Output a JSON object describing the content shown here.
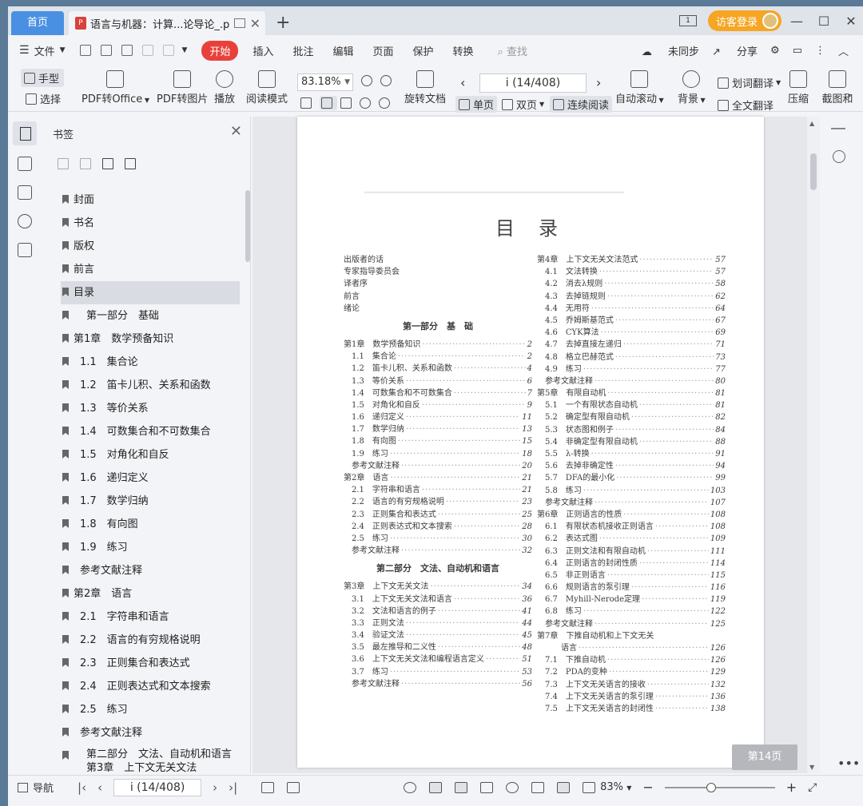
{
  "tabs": {
    "home": "首页",
    "doc_title": "语言与机器：计算...论导论_.pdf",
    "login": "访客登录"
  },
  "menu": {
    "file": "文件",
    "items": [
      "开始",
      "插入",
      "批注",
      "编辑",
      "页面",
      "保护",
      "转换"
    ],
    "search": "查找",
    "right": [
      "未同步",
      "分享"
    ]
  },
  "ribbon": {
    "hand": "手型",
    "select": "选择",
    "pdf_office": "PDF转Office",
    "pdf_image": "PDF转图片",
    "play": "播放",
    "read_mode": "阅读模式",
    "zoom": "83.18%",
    "rotate_doc": "旋转文档",
    "page_indicator": "i (14/408)",
    "single": "单页",
    "double": "双页",
    "continuous": "连续阅读",
    "auto_scroll": "自动滚动",
    "background": "背景",
    "word_translate": "划词翻译",
    "full_translate": "全文翻译",
    "compress": "压缩",
    "screenshot": "截图和"
  },
  "bookmarks": {
    "title": "书签",
    "items": [
      "封面",
      "书名",
      "版权",
      "前言",
      "目录",
      "第一部分　基础",
      "第1章　数学预备知识",
      "1.1　集合论",
      "1.2　笛卡儿积、关系和函数",
      "1.3　等价关系",
      "1.4　可数集合和不可数集合",
      "1.5　对角化和自反",
      "1.6　递归定义",
      "1.7　数学归纳",
      "1.8　有向图",
      "1.9　练习",
      "参考文献注释",
      "第2章　语言",
      "2.1　字符串和语言",
      "2.2　语言的有穷规格说明",
      "2.3　正则集合和表达式",
      "2.4　正则表达式和文本搜索",
      "2.5　练习",
      "参考文献注释",
      "第二部分　文法、自动机和语言第3章　上下文无关文法"
    ]
  },
  "toc": {
    "title": "目录",
    "front": [
      "出版者的话",
      "专家指导委员会",
      "译者序",
      "前言",
      "绪论"
    ],
    "part1": "第一部分　基　础",
    "part2": "第二部分　文法、自动机和语言",
    "left": [
      {
        "t": "第1章　数学预备知识",
        "p": "2",
        "ch": true
      },
      {
        "t": "1.1　集合论",
        "p": "2"
      },
      {
        "t": "1.2　笛卡儿积、关系和函数",
        "p": "4"
      },
      {
        "t": "1.3　等价关系",
        "p": "6"
      },
      {
        "t": "1.4　可数集合和不可数集合",
        "p": "7"
      },
      {
        "t": "1.5　对角化和自反",
        "p": "9"
      },
      {
        "t": "1.6　递归定义",
        "p": "11"
      },
      {
        "t": "1.7　数学归纳",
        "p": "13"
      },
      {
        "t": "1.8　有向图",
        "p": "15"
      },
      {
        "t": "1.9　练习",
        "p": "18"
      },
      {
        "t": "参考文献注释",
        "p": "20"
      },
      {
        "t": "第2章　语言",
        "p": "21",
        "ch": true
      },
      {
        "t": "2.1　字符串和语言",
        "p": "21"
      },
      {
        "t": "2.2　语言的有穷规格说明",
        "p": "23"
      },
      {
        "t": "2.3　正则集合和表达式",
        "p": "25"
      },
      {
        "t": "2.4　正则表达式和文本搜索",
        "p": "28"
      },
      {
        "t": "2.5　练习",
        "p": "30"
      },
      {
        "t": "参考文献注释",
        "p": "32"
      }
    ],
    "left2": [
      {
        "t": "第3章　上下文无关文法",
        "p": "34",
        "ch": true
      },
      {
        "t": "3.1　上下文无关文法和语言",
        "p": "36"
      },
      {
        "t": "3.2　文法和语言的例子",
        "p": "41"
      },
      {
        "t": "3.3　正则文法",
        "p": "44"
      },
      {
        "t": "3.4　验证文法",
        "p": "45"
      },
      {
        "t": "3.5　最左推导和二义性",
        "p": "48"
      },
      {
        "t": "3.6　上下文无关文法和编程语言定义",
        "p": "51"
      },
      {
        "t": "3.7　练习",
        "p": "53"
      },
      {
        "t": "参考文献注释",
        "p": "56"
      }
    ],
    "right": [
      {
        "t": "第4章　上下文无关文法范式",
        "p": "57",
        "ch": true
      },
      {
        "t": "4.1　文法转换",
        "p": "57"
      },
      {
        "t": "4.2　消去λ规则",
        "p": "58"
      },
      {
        "t": "4.3　去掉链规则",
        "p": "62"
      },
      {
        "t": "4.4　无用符",
        "p": "64"
      },
      {
        "t": "4.5　乔姆斯基范式",
        "p": "67"
      },
      {
        "t": "4.6　CYK算法",
        "p": "69"
      },
      {
        "t": "4.7　去掉直接左递归",
        "p": "71"
      },
      {
        "t": "4.8　格立巴赫范式",
        "p": "73"
      },
      {
        "t": "4.9　练习",
        "p": "77"
      },
      {
        "t": "参考文献注释",
        "p": "80"
      },
      {
        "t": "第5章　有限自动机",
        "p": "81",
        "ch": true
      },
      {
        "t": "5.1　一个有限状态自动机",
        "p": "81"
      },
      {
        "t": "5.2　确定型有限自动机",
        "p": "82"
      },
      {
        "t": "5.3　状态图和例子",
        "p": "84"
      },
      {
        "t": "5.4　非确定型有限自动机",
        "p": "88"
      },
      {
        "t": "5.5　λ-转换",
        "p": "91"
      },
      {
        "t": "5.6　去掉非确定性",
        "p": "94"
      },
      {
        "t": "5.7　DFA的最小化",
        "p": "99"
      },
      {
        "t": "5.8　练习",
        "p": "103"
      },
      {
        "t": "参考文献注释",
        "p": "107"
      },
      {
        "t": "第6章　正则语言的性质",
        "p": "108",
        "ch": true
      },
      {
        "t": "6.1　有限状态机接收正则语言",
        "p": "108"
      },
      {
        "t": "6.2　表达式图",
        "p": "109"
      },
      {
        "t": "6.3　正则文法和有限自动机",
        "p": "111"
      },
      {
        "t": "6.4　正则语言的封闭性质",
        "p": "114"
      },
      {
        "t": "6.5　非正则语言",
        "p": "115"
      },
      {
        "t": "6.6　规则语言的泵引理",
        "p": "116"
      },
      {
        "t": "6.7　Myhill-Nerode定理",
        "p": "119"
      },
      {
        "t": "6.8　练习",
        "p": "122"
      },
      {
        "t": "参考文献注释",
        "p": "125"
      },
      {
        "t": "第7章　下推自动机和上下文无关",
        "p": "",
        "ch": true,
        "plain": true
      },
      {
        "t": "　　　语言",
        "p": "126",
        "ch": true
      },
      {
        "t": "7.1　下推自动机",
        "p": "126"
      },
      {
        "t": "7.2　PDA的变种",
        "p": "129"
      },
      {
        "t": "7.3　上下文无关语言的接收",
        "p": "132"
      },
      {
        "t": "7.4　上下文无关语言的泵引理",
        "p": "136"
      },
      {
        "t": "7.5　上下文无关语言的封闭性",
        "p": "138"
      }
    ]
  },
  "page_badge": "第14页",
  "status": {
    "nav": "导航",
    "page": "i (14/408)",
    "zoom": "83%"
  }
}
